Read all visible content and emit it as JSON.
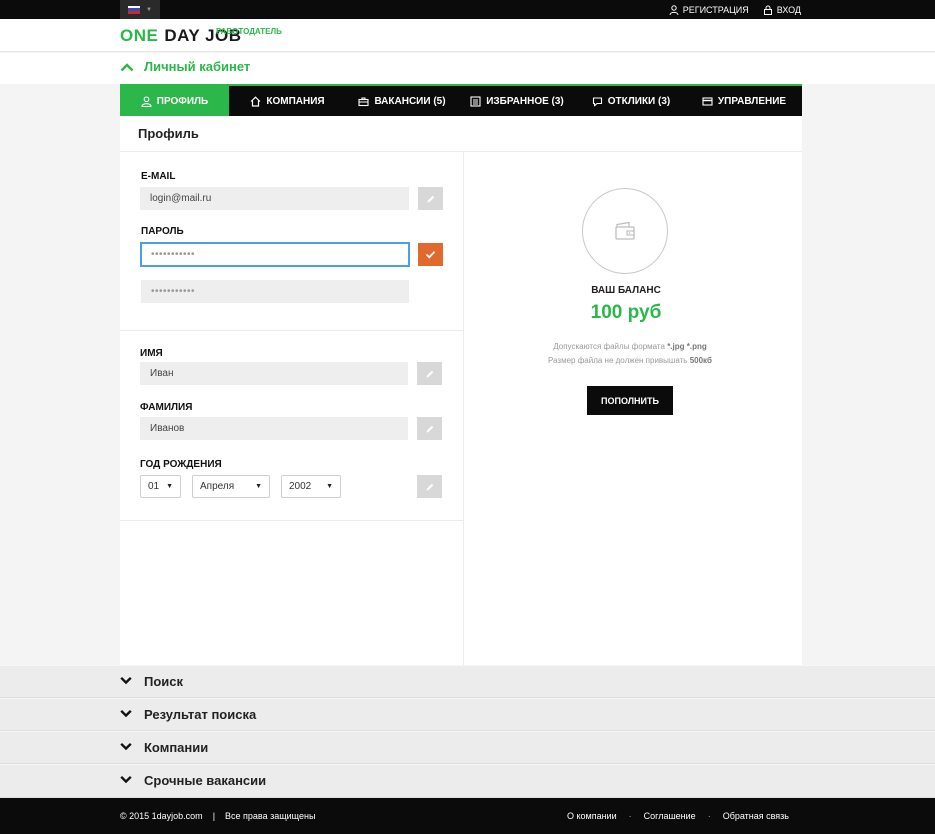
{
  "topbar": {
    "language_flag": "flag-ru-icon",
    "links": [
      {
        "label": "Регистрация",
        "icon": "user-icon"
      },
      {
        "label": "Вход",
        "icon": "lock-icon"
      }
    ]
  },
  "header": {
    "logo_one": "ONE",
    "logo_rest": "DAY JOB",
    "logo_sub": "Работодатель"
  },
  "cabinet": {
    "title": "Личный кабинет"
  },
  "tabs": [
    {
      "label": "Профиль",
      "icon": "user-icon",
      "active": true
    },
    {
      "label": "Компания",
      "icon": "home-icon"
    },
    {
      "label": "Вакансии (5)",
      "icon": "briefcase-icon"
    },
    {
      "label": "Избранное (3)",
      "icon": "list-icon"
    },
    {
      "label": "Отклики (3)",
      "icon": "chat-icon"
    },
    {
      "label": "Управление",
      "icon": "card-icon"
    }
  ],
  "profile": {
    "title": "Профиль",
    "email_label": "E-MAIL",
    "email_value": "login@mail.ru",
    "password_label": "Пароль",
    "password_value": "•••••••••••",
    "password_confirm_value": "•••••••••••",
    "first_name_label": "Имя",
    "first_name_value": "Иван",
    "last_name_label": "Фамилия",
    "last_name_value": "Иванов",
    "birth_label": "Год рождения",
    "birth_day": "01",
    "birth_month": "Апреля",
    "birth_year": "2002"
  },
  "balance": {
    "label": "Ваш баланс",
    "value": "100 руб",
    "hint_line1_text": "Допускаются файлы формата",
    "hint_line1_bold": "*.jpg *.png",
    "hint_line2_text": "Размер файла не должен привышать",
    "hint_line2_bold": "500кб",
    "button_label": "Пополнить"
  },
  "sections": [
    {
      "label": "Поиск"
    },
    {
      "label": "Результат поиска"
    },
    {
      "label": "Компании"
    },
    {
      "label": "Срочные вакансии"
    }
  ],
  "footer": {
    "copyright": "© 2015 1dayjob.com",
    "separator": "|",
    "rights": "Все права защищены",
    "links": [
      "О компании",
      "Соглашение",
      "Обратная связь"
    ],
    "dot": "·"
  },
  "colors": {
    "accent": "#2bb74a",
    "confirm": "#e2692e",
    "dark": "#0b0b0b",
    "focus": "#4aa0e6"
  }
}
